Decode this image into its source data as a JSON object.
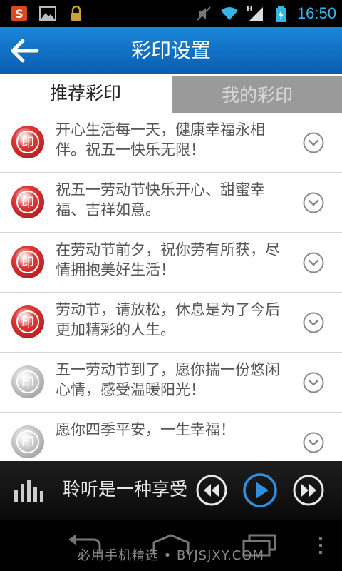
{
  "status_bar": {
    "time": "16:50",
    "left_icons": [
      "sogou-input-icon",
      "image-icon",
      "lock-icon"
    ],
    "right_icons": [
      "mute-icon",
      "wifi-icon",
      "signal-icon",
      "battery-icon"
    ],
    "network_type": "H"
  },
  "header": {
    "title": "彩印设置",
    "back_icon": "back-arrow-icon"
  },
  "tabs": [
    {
      "label": "推荐彩印",
      "active": true
    },
    {
      "label": "我的彩印",
      "active": false
    }
  ],
  "list": {
    "items": [
      {
        "text": "开心生活每一天，健康幸福永相伴。祝五一快乐无限！",
        "stamp_label": "印",
        "active": true
      },
      {
        "text": "祝五一劳动节快乐开心、甜蜜幸福、吉祥如意。",
        "stamp_label": "印",
        "active": true
      },
      {
        "text": "在劳动节前夕，祝你劳有所获，尽情拥抱美好生活！",
        "stamp_label": "印",
        "active": true
      },
      {
        "text": "劳动节，请放松，休息是为了今后更加精彩的人生。",
        "stamp_label": "印",
        "active": true
      },
      {
        "text": "五一劳动节到了，愿你揣一份悠闲心情，感受温暖阳光！",
        "stamp_label": "印",
        "active": false
      },
      {
        "text": "愿你四季平安，一生幸福！",
        "stamp_label": "印",
        "active": false
      }
    ]
  },
  "player": {
    "now_playing": "聆听是一种享受",
    "icons": [
      "equalizer-icon",
      "rewind-icon",
      "play-icon",
      "fast-forward-icon"
    ]
  },
  "nav_bar": {
    "icons": [
      "back-nav-icon",
      "home-nav-icon",
      "recents-nav-icon",
      "menu-nav-icon"
    ],
    "watermark": "必用手机精选 • BYJSJXY.COM"
  },
  "colors": {
    "title_bar": "#0a5cb0",
    "status_time": "#33b5e5",
    "stamp_active": "#e03a3a",
    "stamp_inactive": "#cfcfcf",
    "play_button": "#2f8fe0"
  }
}
